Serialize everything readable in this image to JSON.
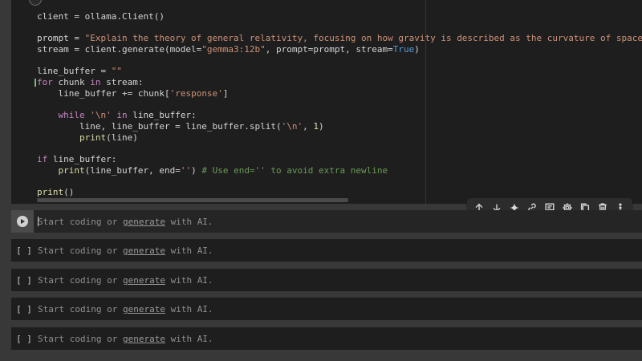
{
  "code_cell": {
    "lines": [
      [
        {
          "t": "client = ollama.Client()",
          "c": ""
        }
      ],
      [
        {
          "t": "",
          "c": ""
        }
      ],
      [
        {
          "t": "prompt = ",
          "c": ""
        },
        {
          "t": "\"Explain the theory of general relativity, focusing on how gravity is described as the curvature of spacetime cause",
          "c": "tk-str"
        }
      ],
      [
        {
          "t": "stream = client.generate(model=",
          "c": ""
        },
        {
          "t": "\"gemma3:12b\"",
          "c": "tk-str"
        },
        {
          "t": ", prompt=prompt, stream=",
          "c": ""
        },
        {
          "t": "True",
          "c": "tk-bool"
        },
        {
          "t": ")",
          "c": ""
        }
      ],
      [
        {
          "t": "",
          "c": ""
        }
      ],
      [
        {
          "t": "line_buffer = ",
          "c": ""
        },
        {
          "t": "\"\"",
          "c": "tk-str"
        }
      ],
      [
        {
          "t": "for",
          "c": "tk-kw"
        },
        {
          "t": " chunk ",
          "c": ""
        },
        {
          "t": "in",
          "c": "tk-kw"
        },
        {
          "t": " stream:",
          "c": ""
        }
      ],
      [
        {
          "t": "    line_buffer += chunk[",
          "c": ""
        },
        {
          "t": "'response'",
          "c": "tk-str"
        },
        {
          "t": "]",
          "c": ""
        }
      ],
      [
        {
          "t": "",
          "c": ""
        }
      ],
      [
        {
          "t": "    ",
          "c": ""
        },
        {
          "t": "while",
          "c": "tk-kw"
        },
        {
          "t": " ",
          "c": ""
        },
        {
          "t": "'\\n'",
          "c": "tk-str"
        },
        {
          "t": " ",
          "c": ""
        },
        {
          "t": "in",
          "c": "tk-kw"
        },
        {
          "t": " line_buffer:",
          "c": ""
        }
      ],
      [
        {
          "t": "        line, line_buffer = line_buffer.split(",
          "c": ""
        },
        {
          "t": "'\\n'",
          "c": "tk-str"
        },
        {
          "t": ", ",
          "c": ""
        },
        {
          "t": "1",
          "c": "tk-fn"
        },
        {
          "t": ")",
          "c": ""
        }
      ],
      [
        {
          "t": "        ",
          "c": ""
        },
        {
          "t": "print",
          "c": "tk-fn"
        },
        {
          "t": "(line)",
          "c": ""
        }
      ],
      [
        {
          "t": "",
          "c": ""
        }
      ],
      [
        {
          "t": "if",
          "c": "tk-kw"
        },
        {
          "t": " line_buffer:",
          "c": ""
        }
      ],
      [
        {
          "t": "    ",
          "c": ""
        },
        {
          "t": "print",
          "c": "tk-fn"
        },
        {
          "t": "(line_buffer, end=",
          "c": ""
        },
        {
          "t": "''",
          "c": "tk-str"
        },
        {
          "t": ") ",
          "c": ""
        },
        {
          "t": "# Use end='' to avoid extra newline",
          "c": "tk-cm"
        }
      ],
      [
        {
          "t": "",
          "c": ""
        }
      ],
      [
        {
          "t": "print",
          "c": "tk-fn"
        },
        {
          "t": "()",
          "c": ""
        }
      ]
    ]
  },
  "toolbar": {
    "buttons": [
      {
        "name": "move-up-button",
        "icon": "arrow-up-icon"
      },
      {
        "name": "move-down-button",
        "icon": "arrow-down-icon"
      },
      {
        "name": "generate-ai-button",
        "icon": "sparkle-icon"
      },
      {
        "name": "link-cell-button",
        "icon": "link-icon"
      },
      {
        "name": "comment-button",
        "icon": "comment-icon"
      },
      {
        "name": "settings-button",
        "icon": "gear-icon"
      },
      {
        "name": "mirror-cell-button",
        "icon": "copy-icon"
      },
      {
        "name": "delete-cell-button",
        "icon": "trash-icon"
      },
      {
        "name": "more-options-button",
        "icon": "more-vertical-icon"
      }
    ]
  },
  "empty_cells": {
    "prompt_label": "[ ]",
    "placeholder_start": "Start coding or ",
    "placeholder_link": "generate",
    "placeholder_end": " with AI."
  }
}
